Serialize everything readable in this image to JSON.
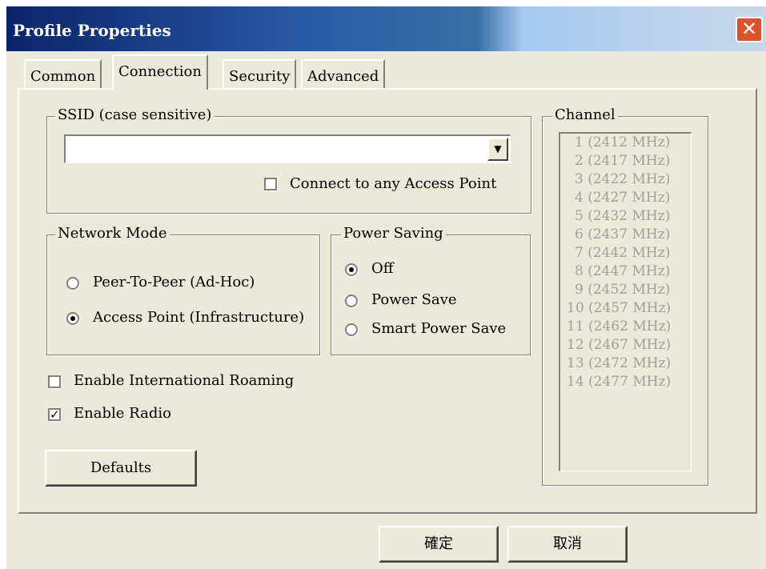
{
  "window": {
    "title": "Profile Properties",
    "close_glyph": "✕"
  },
  "tabs": [
    {
      "label": "Common",
      "selected": false
    },
    {
      "label": "Connection",
      "selected": true
    },
    {
      "label": "Security",
      "selected": false
    },
    {
      "label": "Advanced",
      "selected": false
    }
  ],
  "ssid": {
    "legend": "SSID (case sensitive)",
    "value": "",
    "connect_any_label": "Connect to any Access Point",
    "connect_any_checked": false
  },
  "network_mode": {
    "legend": "Network Mode",
    "options": [
      {
        "label": "Peer-To-Peer (Ad-Hoc)",
        "selected": false
      },
      {
        "label": "Access Point (Infrastructure)",
        "selected": true
      }
    ]
  },
  "power_saving": {
    "legend": "Power Saving",
    "options": [
      {
        "label": "Off",
        "selected": true
      },
      {
        "label": "Power Save",
        "selected": false
      },
      {
        "label": "Smart Power Save",
        "selected": false
      }
    ]
  },
  "options": {
    "roaming_label": "Enable International Roaming",
    "roaming_checked": false,
    "radio_label": "Enable Radio",
    "radio_checked": true
  },
  "defaults_label": "Defaults",
  "channel": {
    "legend": "Channel",
    "items": [
      "1 (2412 MHz)",
      "2 (2417 MHz)",
      "3 (2422 MHz)",
      "4 (2427 MHz)",
      "5 (2432 MHz)",
      "6 (2437 MHz)",
      "7 (2442 MHz)",
      "8 (2447 MHz)",
      "9 (2452 MHz)",
      "10 (2457 MHz)",
      "11 (2462 MHz)",
      "12 (2467 MHz)",
      "13 (2472 MHz)",
      "14 (2477 MHz)"
    ]
  },
  "footer": {
    "ok_label": "確定",
    "cancel_label": "取消"
  },
  "colors": {
    "titlebar": "#0a246a",
    "face": "#ece9d8",
    "close": "#d9532c",
    "disabled_text": "#a0a0a0"
  }
}
